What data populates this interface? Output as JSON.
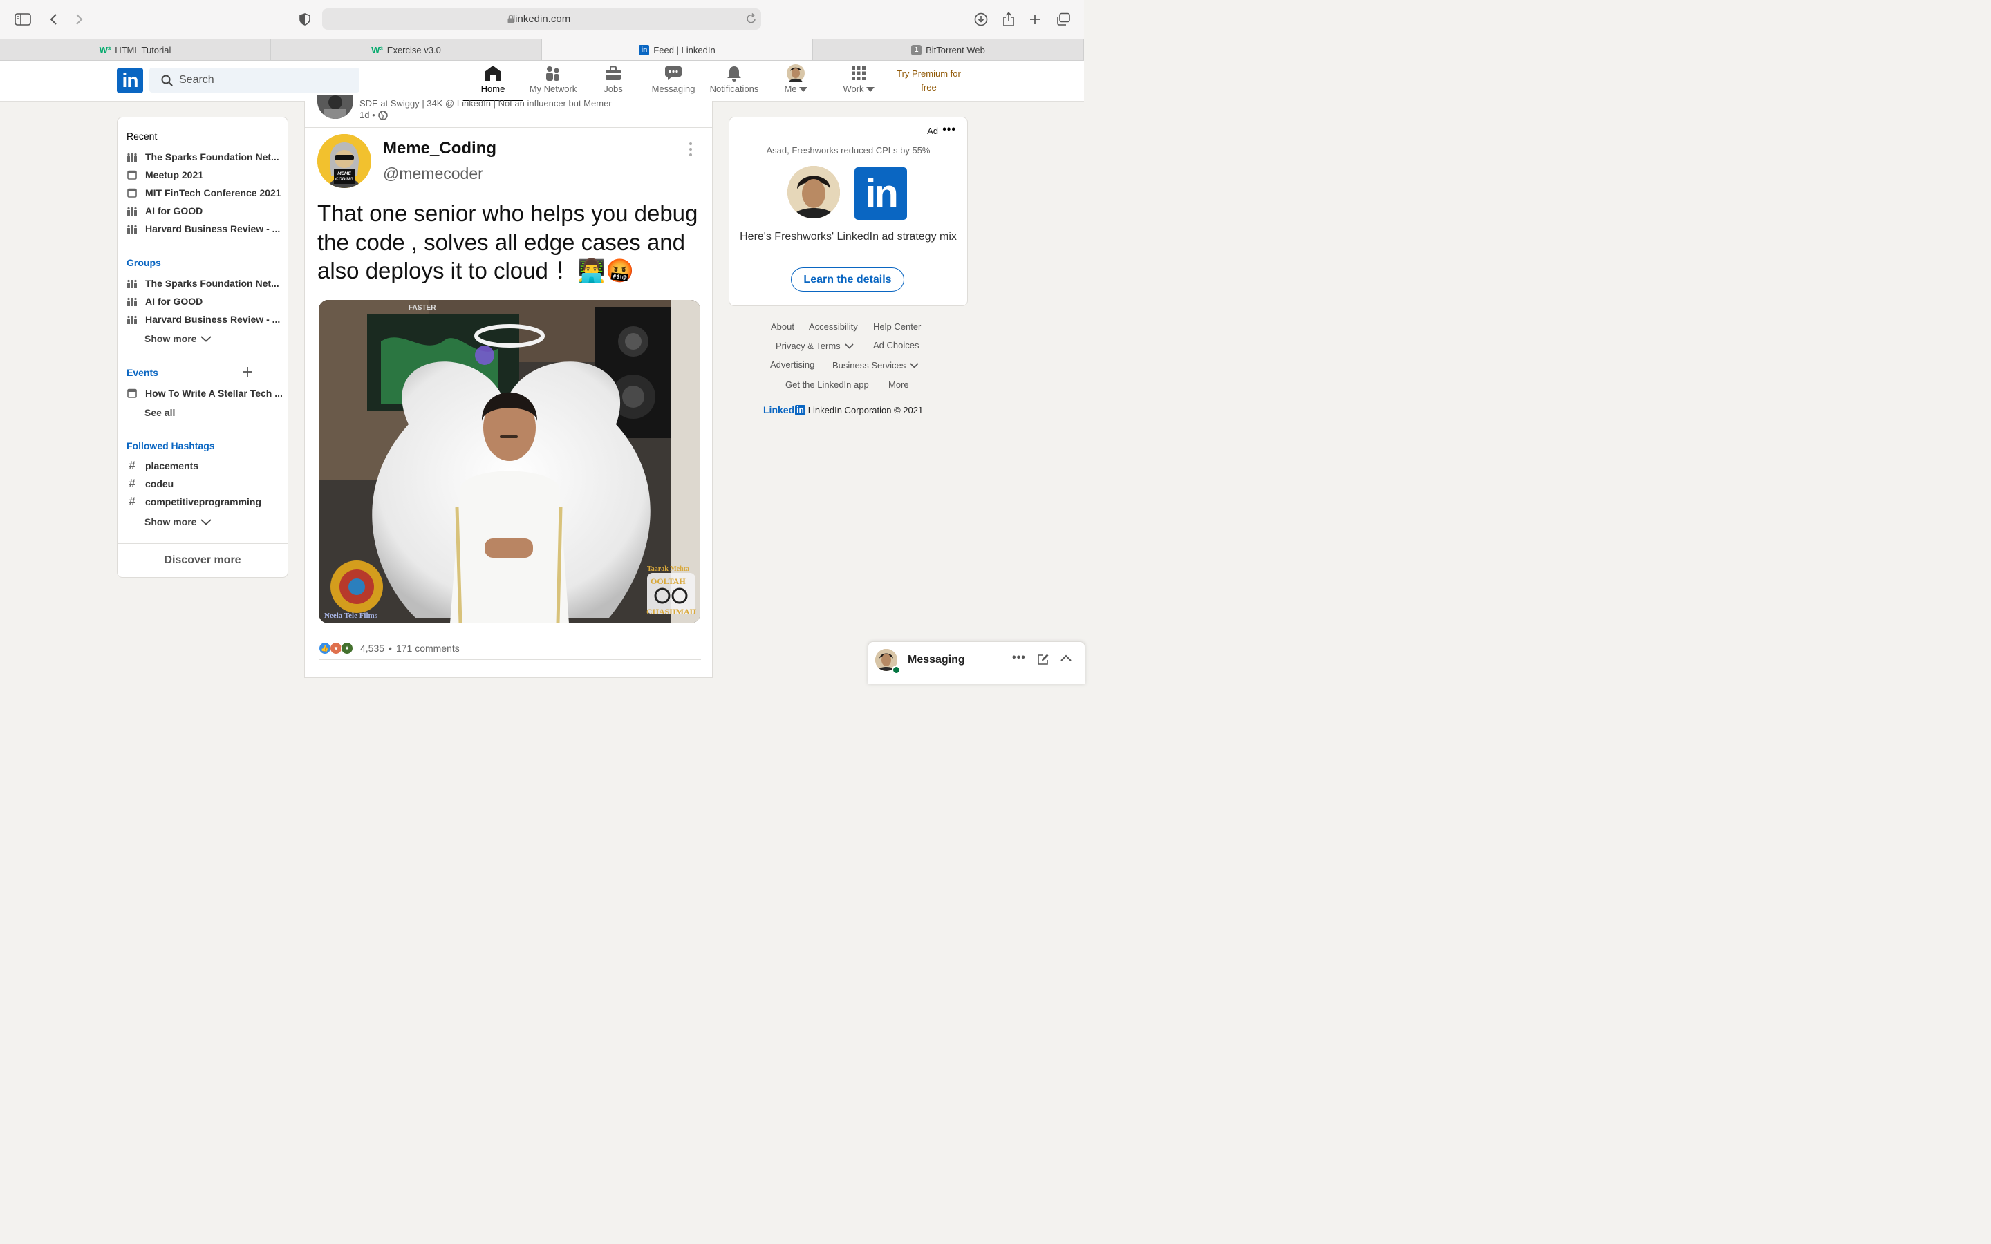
{
  "browser": {
    "url": "linkedin.com",
    "tabs": [
      {
        "label": "HTML Tutorial",
        "icon": "w3schools-icon"
      },
      {
        "label": "Exercise v3.0",
        "icon": "w3schools-icon"
      },
      {
        "label": "Feed | LinkedIn",
        "icon": "linkedin-icon"
      },
      {
        "label": "BitTorrent Web",
        "icon": "bittorrent-icon",
        "badge": "1"
      }
    ]
  },
  "header": {
    "logo": "in",
    "search_placeholder": "Search",
    "nav": [
      {
        "label": "Home",
        "icon": "home-icon",
        "active": true
      },
      {
        "label": "My Network",
        "icon": "my-network-icon"
      },
      {
        "label": "Jobs",
        "icon": "briefcase-icon"
      },
      {
        "label": "Messaging",
        "icon": "messaging-icon"
      },
      {
        "label": "Notifications",
        "icon": "bell-icon"
      },
      {
        "label": "Me",
        "icon": "avatar"
      },
      {
        "label": "Work",
        "icon": "grid-icon"
      }
    ],
    "premium_line1": "Try Premium for",
    "premium_line2": "free"
  },
  "sidebar": {
    "recent_title": "Recent",
    "recent": [
      {
        "label": "The Sparks Foundation Net...",
        "icon": "group-icon"
      },
      {
        "label": "Meetup 2021",
        "icon": "calendar-icon"
      },
      {
        "label": "MIT FinTech Conference 2021",
        "icon": "calendar-icon"
      },
      {
        "label": "AI for GOOD",
        "icon": "group-icon"
      },
      {
        "label": "Harvard Business Review - ...",
        "icon": "group-icon"
      }
    ],
    "groups_title": "Groups",
    "groups": [
      {
        "label": "The Sparks Foundation Net..."
      },
      {
        "label": "AI for GOOD"
      },
      {
        "label": "Harvard Business Review - ..."
      }
    ],
    "groups_show_more": "Show more",
    "events_title": "Events",
    "events": [
      {
        "label": "How To Write A Stellar Tech ..."
      }
    ],
    "events_see_all": "See all",
    "hashtags_title": "Followed Hashtags",
    "hashtags": [
      {
        "label": "placements"
      },
      {
        "label": "codeu"
      },
      {
        "label": "competitiveprogramming"
      }
    ],
    "hashtags_show_more": "Show more",
    "discover": "Discover more"
  },
  "post": {
    "author_subtitle": "SDE at Swiggy | 34K @ LinkedIn | Not an influencer but Memer",
    "time": "1d •",
    "tweet_name": "Meme_Coding",
    "tweet_handle": "@memecoder",
    "tweet_text": "That one senior who helps you debug the code , solves all edge cases and also deploys it to cloud ！👨‍💻🤬",
    "avatar_caption": "MEME CODING",
    "image_label_top": "FASTER",
    "image_watermark_left": "Neela Tele Films",
    "image_watermark_right_1": "Taarak Mehta",
    "image_watermark_right_2": "OOLTAH",
    "image_watermark_right_3": "CHASHMAH",
    "reactions_count": "4,535",
    "comments": "171 comments",
    "dot": "•"
  },
  "ad": {
    "label": "Ad",
    "subtitle": "Asad, Freshworks reduced CPLs by 55%",
    "logo": "in",
    "headline": "Here's Freshworks' LinkedIn ad strategy mix",
    "cta": "Learn the details"
  },
  "footer": {
    "about": "About",
    "accessibility": "Accessibility",
    "help": "Help Center",
    "privacy": "Privacy & Terms",
    "ad_choices": "Ad Choices",
    "advertising": "Advertising",
    "business": "Business Services",
    "app": "Get the LinkedIn app",
    "more": "More",
    "brand_word": "Linked",
    "brand_in": "in",
    "copyright": "LinkedIn Corporation © 2021"
  },
  "messaging": {
    "label": "Messaging"
  },
  "colors": {
    "brand": "#0a66c2",
    "premium": "#915907",
    "background": "#f3f2ef"
  }
}
